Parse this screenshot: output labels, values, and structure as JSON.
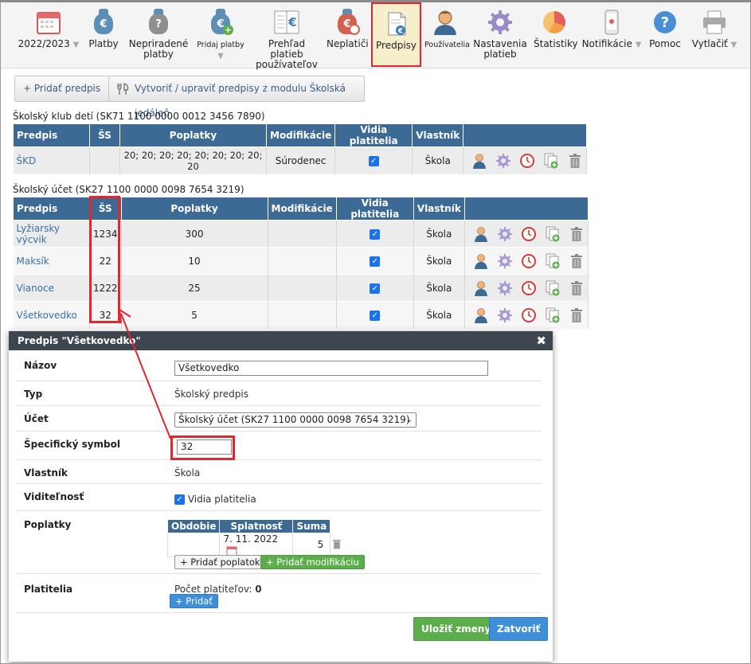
{
  "toolbar": {
    "year": "2022/2023",
    "payments": "Platby",
    "unassigned_line1": "Nepriradené",
    "unassigned_line2": "platby",
    "add_payments": "Pridaj platby",
    "overview_line1": "Prehľad platieb",
    "overview_line2": "používateľov",
    "nonpayers": "Neplatiči",
    "predpisy": "Predpisy",
    "users": "Používatelia",
    "settings_line1": "Nastavenia",
    "settings_line2": "platieb",
    "stats": "Štatistiky",
    "notifications": "Notifikácie",
    "help": "Pomoc",
    "print": "Vytlačiť"
  },
  "actions": {
    "add_predpis": "+ Pridať predpis",
    "create_jedalen": "Vytvoriť / upraviť predpisy z modulu Školská jedáleň"
  },
  "columns": [
    "Predpis",
    "ŠS",
    "Poplatky",
    "Modifikácie",
    "Vidia platitelia",
    "Vlastník"
  ],
  "club": {
    "title": "Školský klub detí (SK71 1100 0000 0012 3456 7890)",
    "rows": [
      {
        "name": "ŠKD",
        "ss": "",
        "fees": "20; 20; 20; 20; 20; 20; 20; 20; 20",
        "mod": "Súrodenec",
        "owner": "Škola"
      }
    ]
  },
  "school": {
    "title": "Školský účet (SK27 1100 0000 0098 7654 3219)",
    "rows": [
      {
        "name": "Lyžiarsky výcvik",
        "ss": "1234",
        "fees": "300",
        "mod": "",
        "owner": "Škola"
      },
      {
        "name": "Maksík",
        "ss": "22",
        "fees": "10",
        "mod": "",
        "owner": "Škola"
      },
      {
        "name": "Vianoce",
        "ss": "1222",
        "fees": "25",
        "mod": "",
        "owner": "Škola"
      },
      {
        "name": "Všetkovedko",
        "ss": "32",
        "fees": "5",
        "mod": "",
        "owner": "Škola"
      }
    ]
  },
  "dialog": {
    "title": "Predpis \"Všetkovedko\"",
    "close": "✖",
    "name_label": "Názov",
    "name_value": "Všetkovedko",
    "type_label": "Typ",
    "type_value": "Školský predpis",
    "account_label": "Účet",
    "account_value": "Školský účet (SK27 1100 0000 0098 7654 3219)",
    "ss_label": "Špecifický symbol",
    "ss_value": "32",
    "owner_label": "Vlastník",
    "owner_value": "Škola",
    "visibility_label": "Viditeľnosť",
    "visibility_value": "Vidia platitelia",
    "fees_label": "Poplatky",
    "fees_cols": [
      "Obdobie",
      "Splatnosť",
      "Suma"
    ],
    "fee_date": "7. 11. 2022",
    "fee_amount": "5",
    "add_fee": "+ Pridať poplatok",
    "add_mod": "+ Pridať modifikáciu",
    "payers_label": "Platitelia",
    "payers_count_label": "Počet platiteľov:",
    "payers_count": "0",
    "add_payer": "+ Pridať",
    "save": "Uložiť zmeny",
    "close_btn": "Zatvoriť"
  },
  "colors": {
    "header": "#3c6a95",
    "highlight": "#e0262f",
    "save": "#5cae4c",
    "close": "#3e8fd8"
  }
}
